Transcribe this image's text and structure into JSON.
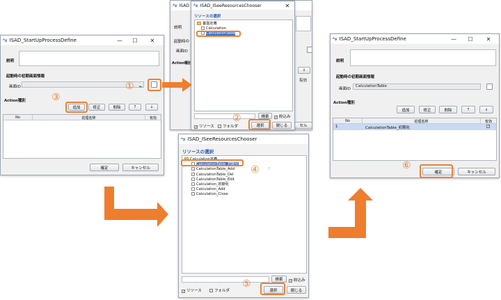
{
  "colors": {
    "accent": "#e9813a",
    "arrow": "#ef7d2e",
    "window_bg": "#f0f0f0",
    "title_link": "#2255aa"
  },
  "icons": {
    "app_logo": "isad-logo-icon",
    "minimize": "minimize-icon",
    "maximize": "maximize-icon",
    "close": "close-icon"
  },
  "define_window_1": {
    "title": "ISAD_StartUpProcessDefine",
    "minimize": "—",
    "maximize": "☐",
    "close": "✕",
    "description_label": "説明",
    "init_screen_label": "起動時の初期画面情報",
    "screen_id_label": "画面ID",
    "screen_id_value": "",
    "action_type_label": "Action種別",
    "add_button": "追加",
    "edit_button": "修正",
    "delete_button": "削除",
    "up_button": "↑",
    "down_button": "↓",
    "columns": [
      "No",
      "処理名称",
      "有効"
    ],
    "confirm_button": "確定",
    "cancel_button": "キャンセル"
  },
  "chooser_window_1": {
    "title": "ISAD_ISeeResourcesChooser",
    "close": "✕",
    "heading": "リソースの選択",
    "tree": [
      {
        "label": "基盤定義",
        "kind": "folder"
      },
      {
        "label": "Calculation",
        "kind": "file"
      },
      {
        "label": "CalculationTable",
        "kind": "file"
      }
    ],
    "search_button": "検索",
    "filter_label": "絞込み",
    "resource_label": "リソース",
    "folder_label": "フォルダ",
    "select_button": "選択",
    "close_button": "閉じる"
  },
  "chooser_window_2": {
    "title": "ISAD_ISeeResourcesChooser",
    "heading": "リソースの選択",
    "tree_header": "Calculation定義",
    "tree": [
      "CalculationTable_初期化",
      "CalculationTable_Add",
      "CalculationTable_Del",
      "CalculationTable_Edit",
      "Calculation_初期化",
      "Calculation_Add",
      "Calculation_Close"
    ],
    "search_button": "検索",
    "filter_label": "絞込み",
    "resource_label": "リソース",
    "folder_label": "フォルダ",
    "select_button": "選択",
    "close_button": "閉じる"
  },
  "define_window_2": {
    "title": "ISAD_StartUpProcessDefine",
    "minimize": "—",
    "maximize": "☐",
    "close": "✕",
    "description_label": "説明",
    "init_screen_label": "起動時の初期画面情報",
    "screen_id_label": "画面ID",
    "screen_id_value": "CalculationTable",
    "action_type_label": "Action種別",
    "add_button": "追加",
    "edit_button": "修正",
    "delete_button": "削除",
    "up_button": "↑",
    "down_button": "↓",
    "columns": [
      "No",
      "処理名称",
      "有効"
    ],
    "rows": [
      {
        "no": "1",
        "name": "CalculationTable_初期化",
        "enabled": "✓"
      }
    ],
    "confirm_button": "確定",
    "cancel_button": "キャンセル"
  },
  "steps": {
    "s1": "①",
    "s2": "②",
    "s3": "③",
    "s4": "④",
    "s5": "⑤",
    "s6": "⑥"
  }
}
